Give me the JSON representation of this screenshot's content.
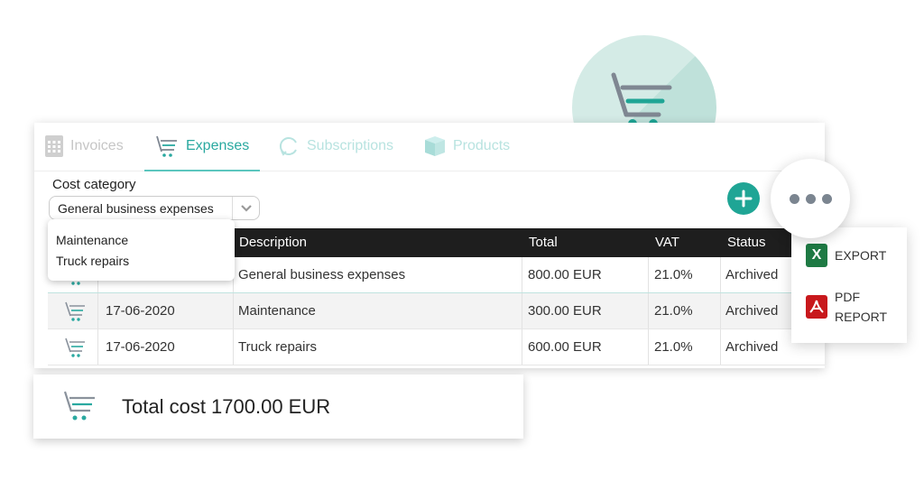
{
  "hero": {
    "icon": "shopping-cart-icon"
  },
  "tabs": [
    {
      "label": "Invoices",
      "icon": "calculator-icon",
      "active": false
    },
    {
      "label": "Expenses",
      "icon": "shopping-cart-icon",
      "active": true
    },
    {
      "label": "Subscriptions",
      "icon": "refresh-icon",
      "active": false
    },
    {
      "label": "Products",
      "icon": "box-icon",
      "active": false
    }
  ],
  "filter": {
    "label": "Cost category",
    "selected": "General business expenses",
    "options": [
      "Maintenance",
      "Truck repairs"
    ]
  },
  "table": {
    "columns": [
      "",
      "",
      "Description",
      "Total",
      "VAT",
      "Status"
    ],
    "rows": [
      {
        "date": "",
        "description": "General business expenses",
        "total": "800.00 EUR",
        "vat": "21.0%",
        "status": "Archived"
      },
      {
        "date": "17-06-2020",
        "description": "Maintenance",
        "total": "300.00 EUR",
        "vat": "21.0%",
        "status": "Archived"
      },
      {
        "date": "17-06-2020",
        "description": "Truck repairs",
        "total": "600.00 EUR",
        "vat": "21.0%",
        "status": "Archived"
      }
    ]
  },
  "actions": {
    "add": "+",
    "more": "more-options",
    "menu": [
      {
        "badge": "X",
        "label": "EXPORT"
      },
      {
        "badge": "pdf",
        "label": "PDF REPORT"
      }
    ]
  },
  "summary": {
    "text": "Total cost 1700.00 EUR"
  },
  "colors": {
    "accent": "#2aa9a0",
    "add_button": "#1fa595",
    "excel": "#1e7a44",
    "pdf": "#c8181c",
    "header": "#1e1e1e"
  }
}
